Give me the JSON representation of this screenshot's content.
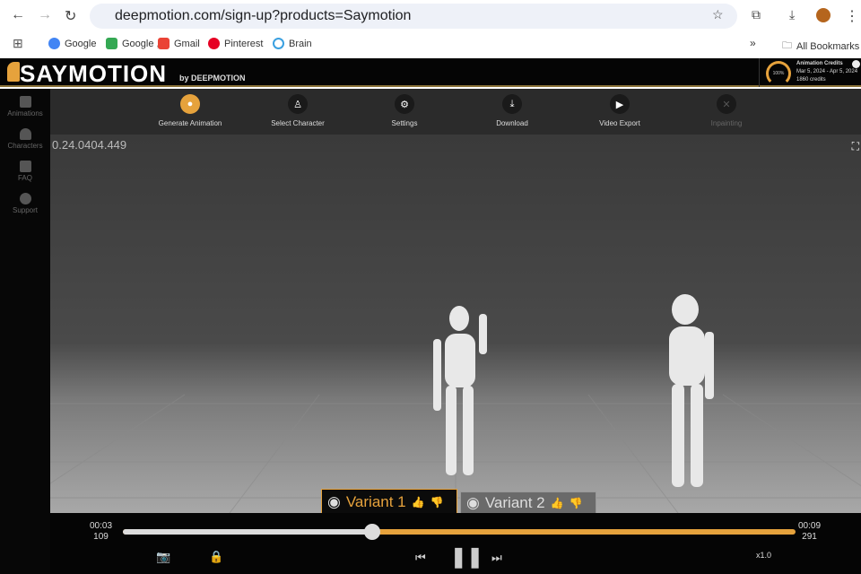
{
  "browser": {
    "url": "deepmotion.com/sign-up?products=Saymotion",
    "bookmarks": [
      "Google",
      "Google ,",
      "Gmail",
      "Pinterest",
      "Brain"
    ],
    "all_bookmarks": "All Bookmarks"
  },
  "app": {
    "logo": "SAYMOTION",
    "by": "by DEEPMOTION",
    "credits": {
      "title": "Animation Credits",
      "period": "Mar 5, 2024 - Apr 5, 2024",
      "amount": "1860 credits",
      "percent": "100%"
    },
    "sidebar": [
      "Animations",
      "Characters",
      "FAQ",
      "Support"
    ],
    "toolbar": [
      "Generate Animation",
      "Select Character",
      "Settings",
      "Download",
      "Video Export",
      "Inpainting"
    ],
    "version": "0.24.0404.449",
    "variants": [
      "Variant 1",
      "Variant 2"
    ],
    "player": {
      "current_time": "00:03",
      "current_frame": "109",
      "end_time": "00:09",
      "end_frame": "291",
      "progress": 0.37,
      "speed": "x1.0"
    },
    "accent": "#e6a23c"
  }
}
